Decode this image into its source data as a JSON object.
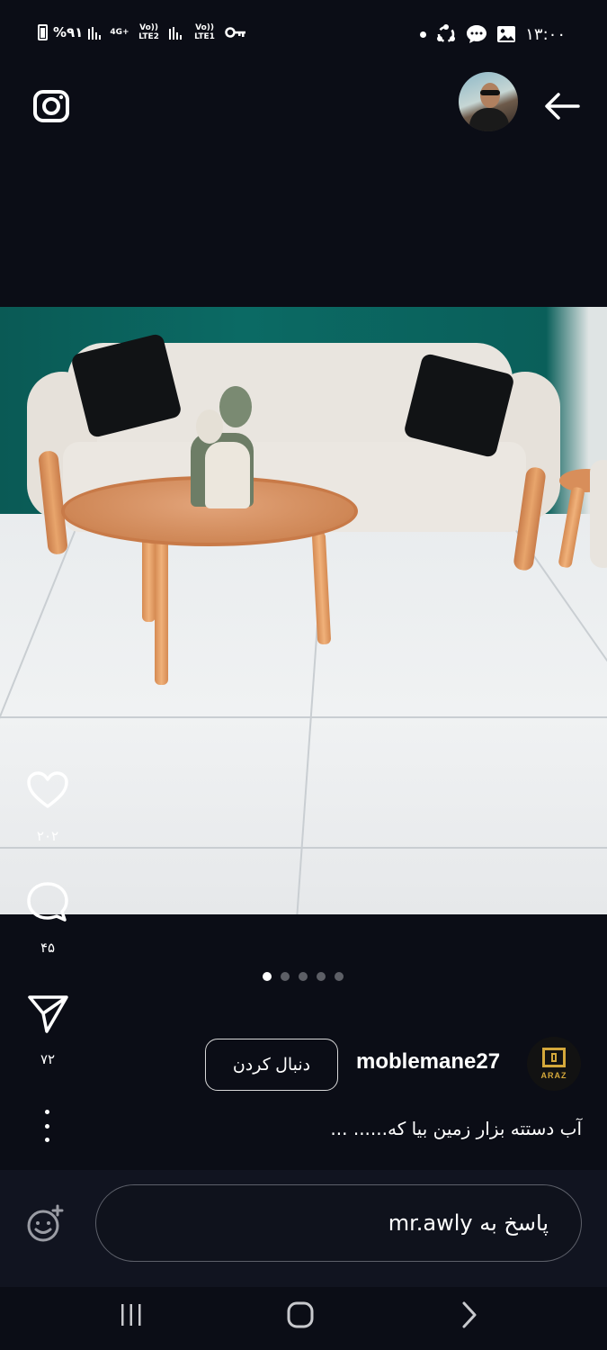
{
  "status_bar": {
    "battery": "%۹۱",
    "network_4g": "4G+",
    "volte_2": "Vo)) LTE2",
    "volte_1": "Vo)) LTE1",
    "time": "۱۳:۰۰"
  },
  "post": {
    "username": "moblemane27",
    "follow_label": "دنبال کردن",
    "caption": "آب دستته بزار زمین بیا که...... ...",
    "logo_text": "ARAZ",
    "likes": "۲۰۲",
    "comments": "۴۵",
    "shares": "۷۲",
    "carousel": {
      "total": 5,
      "current": 1
    }
  },
  "reply": {
    "placeholder": "پاسخ به mr.awly"
  },
  "icons": {
    "camera": "camera-icon",
    "back": "arrow-left-icon",
    "like": "heart-icon",
    "comment": "comment-icon",
    "share": "send-icon",
    "more": "more-vertical-icon",
    "emoji": "emoji-add-icon",
    "nav_recents": "recents-icon",
    "nav_home": "home-icon",
    "nav_back": "chevron-right-icon"
  }
}
